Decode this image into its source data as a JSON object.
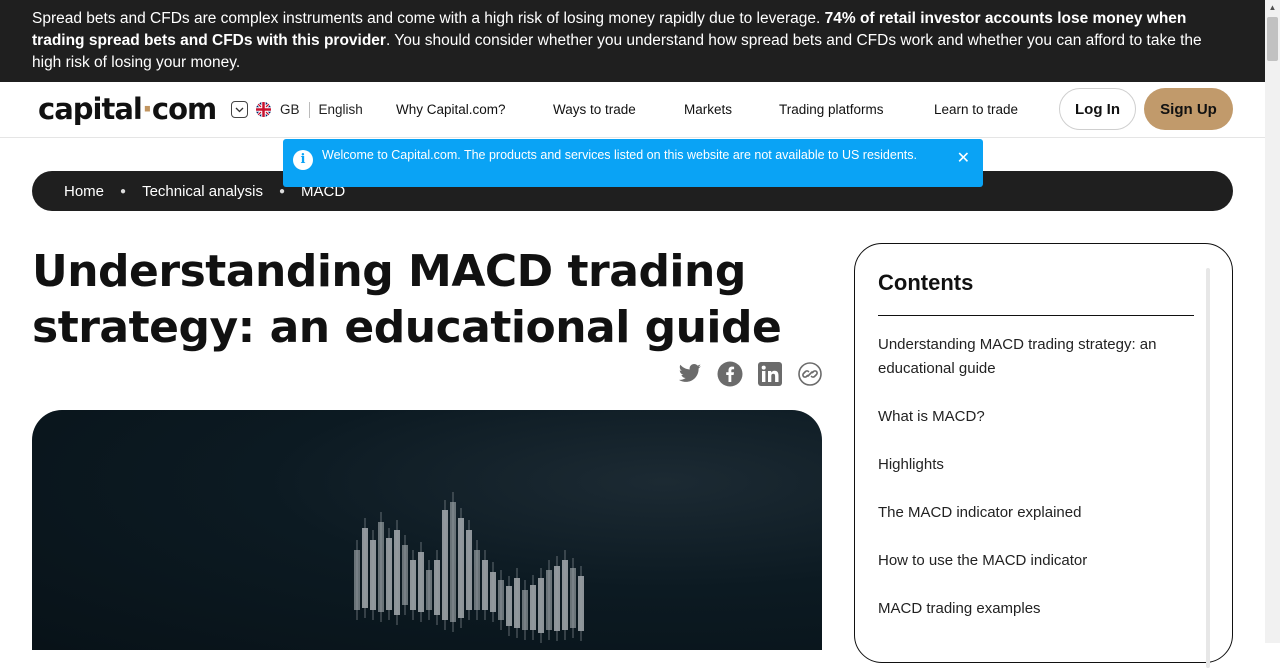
{
  "risk_banner": {
    "text_start": "Spread bets and CFDs are complex instruments and come with a high risk of losing money rapidly due to leverage. ",
    "text_bold": "74% of retail investor accounts lose money when trading spread bets and CFDs with this provider",
    "text_end": ". You should consider whether you understand how spread bets and CFDs work and whether you can afford to take the high risk of losing your money."
  },
  "header": {
    "logo_part1": "capital",
    "logo_dot": "·",
    "logo_part2": "com",
    "region": "GB",
    "language": "English",
    "nav": [
      "Why Capital.com?",
      "Ways to trade",
      "Markets",
      "Trading platforms",
      "Learn to trade"
    ],
    "login_label": "Log In",
    "signup_label": "Sign Up"
  },
  "toast": {
    "message": "Welcome to Capital.com. The products and services listed on this website are not available to US residents.",
    "close_glyph": "✕",
    "info_glyph": "i"
  },
  "breadcrumb": [
    "Home",
    "Technical analysis",
    "MACD"
  ],
  "article": {
    "title": "Understanding MACD trading strategy: an educational guide"
  },
  "share_icons": [
    "twitter-icon",
    "facebook-icon",
    "linkedin-icon",
    "copy-link-icon"
  ],
  "contents": {
    "heading": "Contents",
    "items": [
      "Understanding MACD trading strategy: an educational guide",
      "What is MACD?",
      "Highlights",
      "The MACD indicator explained",
      "How to use the MACD indicator",
      "MACD trading examples"
    ]
  },
  "colors": {
    "banner_bg": "#1f1f1f",
    "brand_accent": "#c19a6b",
    "toast_bg": "#0aa3f5"
  }
}
